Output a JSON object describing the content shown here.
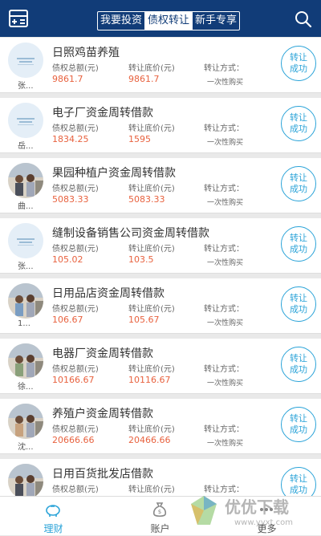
{
  "header": {
    "tabs": [
      "我要投资",
      "债权转让",
      "新手专享"
    ],
    "active_tab": 1
  },
  "labels": {
    "amount": "债权总额(元)",
    "price": "转让底价(元)",
    "method": "转让方式：",
    "method_value": "一次性购买",
    "status_line1": "转让",
    "status_line2": "成功"
  },
  "items": [
    {
      "title": "日照鸡苗养殖",
      "owner": "张...",
      "amount": "9861.7",
      "price": "9861.7",
      "avatar": "logo"
    },
    {
      "title": "电子厂资金周转借款",
      "owner": "岳...",
      "amount": "1834.25",
      "price": "1595",
      "avatar": "logo"
    },
    {
      "title": "果园种植户资金周转借款",
      "owner": "曲...",
      "amount": "5083.33",
      "price": "5083.33",
      "avatar": "photo"
    },
    {
      "title": "缝制设备销售公司资金周转借款",
      "owner": "张...",
      "amount": "105.02",
      "price": "103.5",
      "avatar": "logo"
    },
    {
      "title": "日用品店资金周转借款",
      "owner": "1...",
      "amount": "106.67",
      "price": "105.67",
      "avatar": "photo"
    },
    {
      "title": "电器厂资金周转借款",
      "owner": "徐...",
      "amount": "10166.67",
      "price": "10116.67",
      "avatar": "photo"
    },
    {
      "title": "养殖户资金周转借款",
      "owner": "沈...",
      "amount": "20666.66",
      "price": "20466.66",
      "avatar": "photo"
    },
    {
      "title": "日用百货批发店借款",
      "owner": "",
      "amount": "",
      "price": "",
      "avatar": "photo"
    }
  ],
  "tabbar": {
    "items": [
      "理财",
      "账户",
      "更多"
    ],
    "active": 0
  },
  "watermark": {
    "text": "优优下载",
    "sub": "www.yyxt.com"
  },
  "colors": {
    "header": "#113c78",
    "accent": "#2aa3d8",
    "value": "#e8623f"
  }
}
